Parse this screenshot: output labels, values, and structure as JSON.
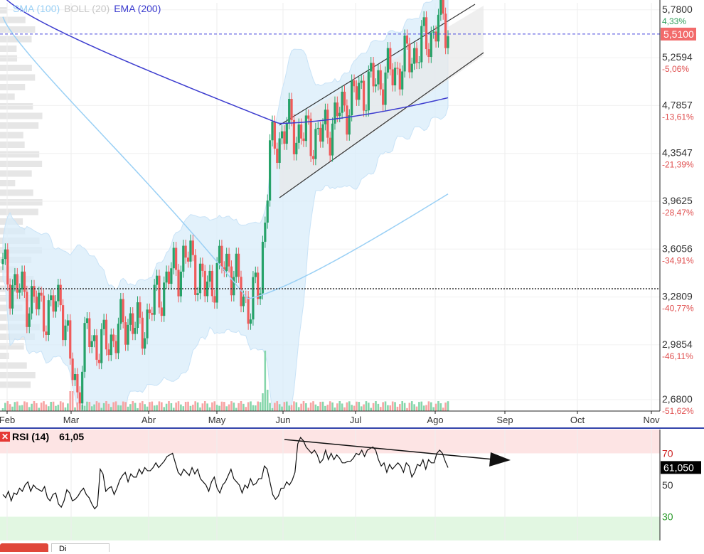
{
  "legend": {
    "sma_label": "SMA (100)",
    "boll_label": "BOLL (20)",
    "ema_label": "EMA (200)",
    "sma_color": "#9ad0f5",
    "boll_color": "#c7c7c7",
    "ema_color": "#3d3dcf"
  },
  "rsi_panel": {
    "label": "RSI (14)",
    "value_text": "61,05",
    "current_badge": "61,050",
    "levels": [
      "70",
      "50",
      "30"
    ]
  },
  "bottom_tabs": {
    "tab_label": "Di"
  },
  "chart_data": {
    "type": "candlestick",
    "x_ticks": [
      "Feb",
      "Mar",
      "Abr",
      "May",
      "Jun",
      "Jul",
      "Ago",
      "Sep",
      "Oct",
      "Nov"
    ],
    "price_ticks": [
      {
        "price": 5.78,
        "label": "5,7800",
        "pct": "4,33%"
      },
      {
        "price": 5.2594,
        "label": "5,2594",
        "pct": "-5,06%"
      },
      {
        "price": 4.7857,
        "label": "4,7857",
        "pct": "-13,61%"
      },
      {
        "price": 4.3547,
        "label": "4,3547",
        "pct": "-21,39%"
      },
      {
        "price": 3.9625,
        "label": "3,9625",
        "pct": "-28,47%"
      },
      {
        "price": 3.6056,
        "label": "3,6056",
        "pct": "-34,91%"
      },
      {
        "price": 3.2809,
        "label": "3,2809",
        "pct": "-40,77%"
      },
      {
        "price": 2.9854,
        "label": "2,9854",
        "pct": "-46,11%"
      },
      {
        "price": 2.68,
        "label": "2,6800",
        "pct": "-51,62%"
      }
    ],
    "price_range": [
      2.62,
      5.86
    ],
    "y_scale": "log",
    "current_price": {
      "price": 5.51,
      "label": "5,5100",
      "color": "#f26b6b"
    },
    "reference_price": 3.335,
    "up_color": "#26a269",
    "down_color": "#f05a5a",
    "rsi_range": [
      15,
      85
    ],
    "rsi_levels": [
      70,
      50,
      30
    ],
    "rsi_current": 61.05,
    "rsi_values": [
      44,
      42,
      46,
      40,
      45,
      44,
      48,
      46,
      50,
      52,
      46,
      50,
      48,
      47,
      46,
      49,
      42,
      40,
      44,
      45,
      38,
      36,
      40,
      47,
      45,
      40,
      41,
      43,
      46,
      48,
      44,
      42,
      38,
      35,
      37,
      60,
      57,
      46,
      48,
      49,
      44,
      48,
      53,
      56,
      58,
      52,
      57,
      55,
      55,
      60,
      57,
      61,
      59,
      59,
      61,
      64,
      61,
      63,
      65,
      68,
      69,
      70,
      64,
      58,
      56,
      60,
      58,
      56,
      61,
      57,
      60,
      54,
      52,
      50,
      46,
      52,
      55,
      48,
      45,
      50,
      52,
      56,
      60,
      54,
      52,
      50,
      45,
      50,
      48,
      54,
      50,
      51,
      54,
      54,
      62,
      60,
      52,
      44,
      41,
      43,
      48,
      48,
      52,
      50,
      53,
      58,
      76,
      80,
      78,
      74,
      72,
      70,
      72,
      69,
      64,
      66,
      72,
      66,
      70,
      66,
      69,
      67,
      64,
      64,
      65,
      65,
      67,
      70,
      69,
      72,
      68,
      72,
      73,
      74,
      72,
      66,
      62,
      64,
      58,
      63,
      60,
      62,
      64,
      62,
      58,
      64,
      62,
      55,
      58,
      63,
      62,
      66,
      60,
      66,
      64,
      64,
      70,
      72,
      70,
      65,
      61
    ]
  }
}
